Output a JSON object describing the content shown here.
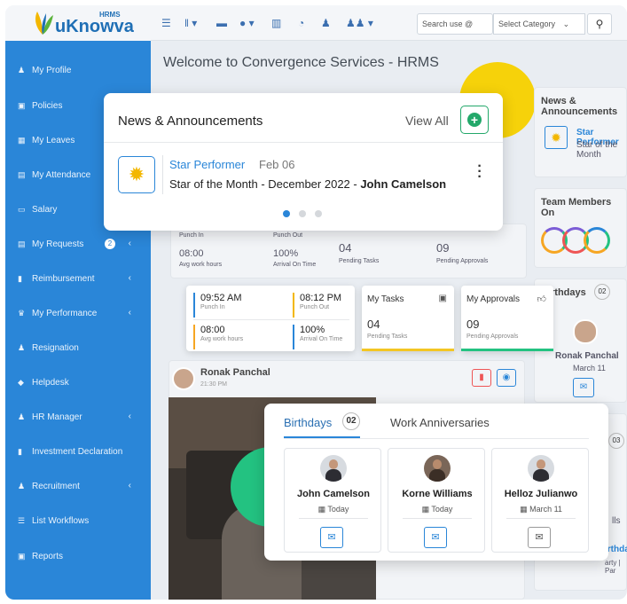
{
  "app": {
    "logo": "uKnowva",
    "logo_sup": "HRMS"
  },
  "topbar": {
    "search_placeholder": "Search use @",
    "category": "Select Category",
    "icons": [
      "list-icon",
      "rss-icon",
      "folder-icon",
      "info-icon",
      "chart-icon",
      "dashboard-icon",
      "user-icon",
      "group-icon"
    ]
  },
  "sidebar": {
    "items": [
      {
        "label": "My Profile",
        "icon": "user-icon"
      },
      {
        "label": "Policies",
        "icon": "copy-icon"
      },
      {
        "label": "My Leaves",
        "icon": "calendar-icon"
      },
      {
        "label": "My Attendance",
        "icon": "calendar-check-icon"
      },
      {
        "label": "Salary",
        "icon": "money-icon"
      },
      {
        "label": "My Requests",
        "icon": "clipboard-icon",
        "badge": "2",
        "chevron": true
      },
      {
        "label": "Reimbursement",
        "icon": "file-icon",
        "chevron": true
      },
      {
        "label": "My Performance",
        "icon": "trophy-icon",
        "chevron": true
      },
      {
        "label": "Resignation",
        "icon": "user-minus-icon"
      },
      {
        "label": "Helpdesk",
        "icon": "ticket-icon"
      },
      {
        "label": "HR Manager",
        "icon": "user-icon",
        "chevron": true
      },
      {
        "label": "Investment Declaration",
        "icon": "file-icon"
      },
      {
        "label": "Recruitment",
        "icon": "user-plus-icon",
        "chevron": true
      },
      {
        "label": "List Workflows",
        "icon": "list-icon"
      },
      {
        "label": "Reports",
        "icon": "copy-icon"
      }
    ]
  },
  "main": {
    "title": "Welcome to Convergence Services - HRMS",
    "post": {
      "author": "Ronak Panchal",
      "time": "21:30 PM"
    }
  },
  "right": {
    "news_title": "News & Announcements",
    "news_item": "Star Performer",
    "news_sub": "Star of the Month",
    "team_title": "Team Members On",
    "bday_title": "Birthdays",
    "bday_count": "02",
    "person": "Ronak Panchal",
    "person_date": "March 11",
    "count2": "03",
    "polls": "lls",
    "birthday_text": "irthda",
    "party_text": "arty | Par"
  },
  "news": {
    "title": "News & Announcements",
    "view_all": "View All",
    "item_title": "Star Performer",
    "item_date": "Feb 06",
    "item_text": "Star of the Month - December 2022 - ",
    "item_person": "John Camelson"
  },
  "attendance": {
    "punch_in": "09:52 AM",
    "punch_in_label": "Punch In",
    "punch_out": "08:12 PM",
    "punch_out_label": "Punch Out",
    "avg_hours": "08:00",
    "avg_hours_label": "Avg work hours",
    "arrival": "100%",
    "arrival_label": "Arrival On Time"
  },
  "bg_attendance": {
    "punch_in_label": "Punch In",
    "punch_out_label": "Punch Out",
    "avg_hours": "08:00",
    "avg_hours_label": "Avg work hours",
    "arrival": "100%",
    "arrival_label": "Arrival On Time",
    "tasks": "04",
    "tasks_label": "Pending Tasks",
    "approvals": "09",
    "approvals_label": "Pending Approvals"
  },
  "tasks": {
    "title": "My Tasks",
    "count": "04",
    "label": "Pending Tasks"
  },
  "approvals": {
    "title": "My Approvals",
    "count": "09",
    "label": "Pending Approvals"
  },
  "birthdays": {
    "tab1": "Birthdays",
    "count": "02",
    "tab2": "Work Anniversaries",
    "people": [
      {
        "name": "John Camelson",
        "date": "Today"
      },
      {
        "name": "Korne Williams",
        "date": "Today"
      },
      {
        "name": "Helloz Julianwo",
        "date": "March 11"
      }
    ]
  },
  "colors": {
    "sidebar": "#2a86d8",
    "accent": "#2a86d8",
    "yellow": "#f6d20a",
    "green": "#23c281"
  }
}
